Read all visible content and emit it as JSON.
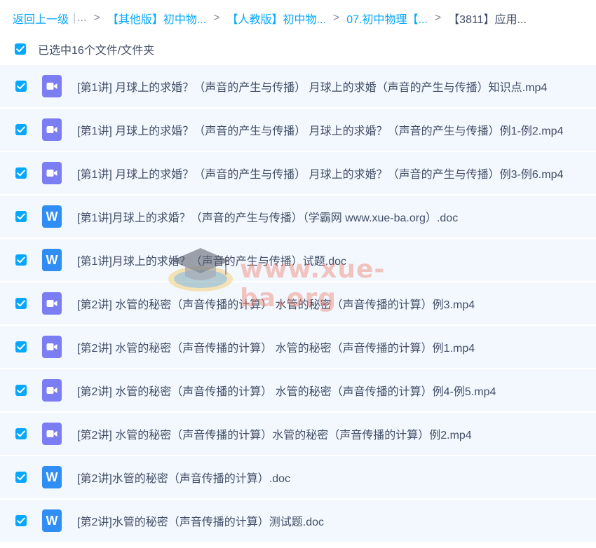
{
  "breadcrumb": {
    "back": "返回上一级",
    "pipe": "|",
    "ellipsis": "...",
    "separator": ">",
    "items": [
      "【其他版】初中物...",
      "【人教版】初中物...",
      "07.初中物理【..."
    ],
    "current": "【3811】应用..."
  },
  "selection": {
    "label": "已选中16个文件/文件夹",
    "checked": true
  },
  "files": [
    {
      "type": "video",
      "icon": "video-icon",
      "name": "[第1讲] 月球上的求婚？（声音的产生与传播） 月球上的求婚（声音的产生与传播）知识点.mp4"
    },
    {
      "type": "video",
      "icon": "video-icon",
      "name": "[第1讲] 月球上的求婚？（声音的产生与传播） 月球上的求婚？（声音的产生与传播）例1-例2.mp4"
    },
    {
      "type": "video",
      "icon": "video-icon",
      "name": "[第1讲] 月球上的求婚？（声音的产生与传播） 月球上的求婚？（声音的产生与传播）例3-例6.mp4"
    },
    {
      "type": "word",
      "icon": "word-icon",
      "icon_letter": "W",
      "name": "[第1讲]月球上的求婚？（声音的产生与传播）（学霸网 www.xue-ba.org）.doc"
    },
    {
      "type": "word",
      "icon": "word-icon",
      "icon_letter": "W",
      "name": "[第1讲]月球上的求婚？（声音的产生与传播）试题.doc"
    },
    {
      "type": "video",
      "icon": "video-icon",
      "name": "[第2讲] 水管的秘密（声音传播的计算） 水管的秘密（声音传播的计算）例3.mp4"
    },
    {
      "type": "video",
      "icon": "video-icon",
      "name": "[第2讲] 水管的秘密（声音传播的计算） 水管的秘密（声音传播的计算）例1.mp4"
    },
    {
      "type": "video",
      "icon": "video-icon",
      "name": "[第2讲] 水管的秘密（声音传播的计算） 水管的秘密（声音传播的计算）例4-例5.mp4"
    },
    {
      "type": "video",
      "icon": "video-icon",
      "name": "[第2讲] 水管的秘密（声音传播的计算）水管的秘密（声音传播的计算）例2.mp4"
    },
    {
      "type": "word",
      "icon": "word-icon",
      "icon_letter": "W",
      "name": "[第2讲]水管的秘密（声音传播的计算）.doc"
    },
    {
      "type": "word",
      "icon": "word-icon",
      "icon_letter": "W",
      "name": "[第2讲]水管的秘密（声音传播的计算）测试题.doc"
    }
  ],
  "watermark": {
    "text": "www.xue-ba.org",
    "icon": "graduation-cap-icon"
  },
  "colors": {
    "accent": "#06a7ff",
    "row_background": "#f2f8fe",
    "video_icon": "#7b7df2",
    "word_icon": "#2f8df4",
    "text": "#424e67"
  }
}
